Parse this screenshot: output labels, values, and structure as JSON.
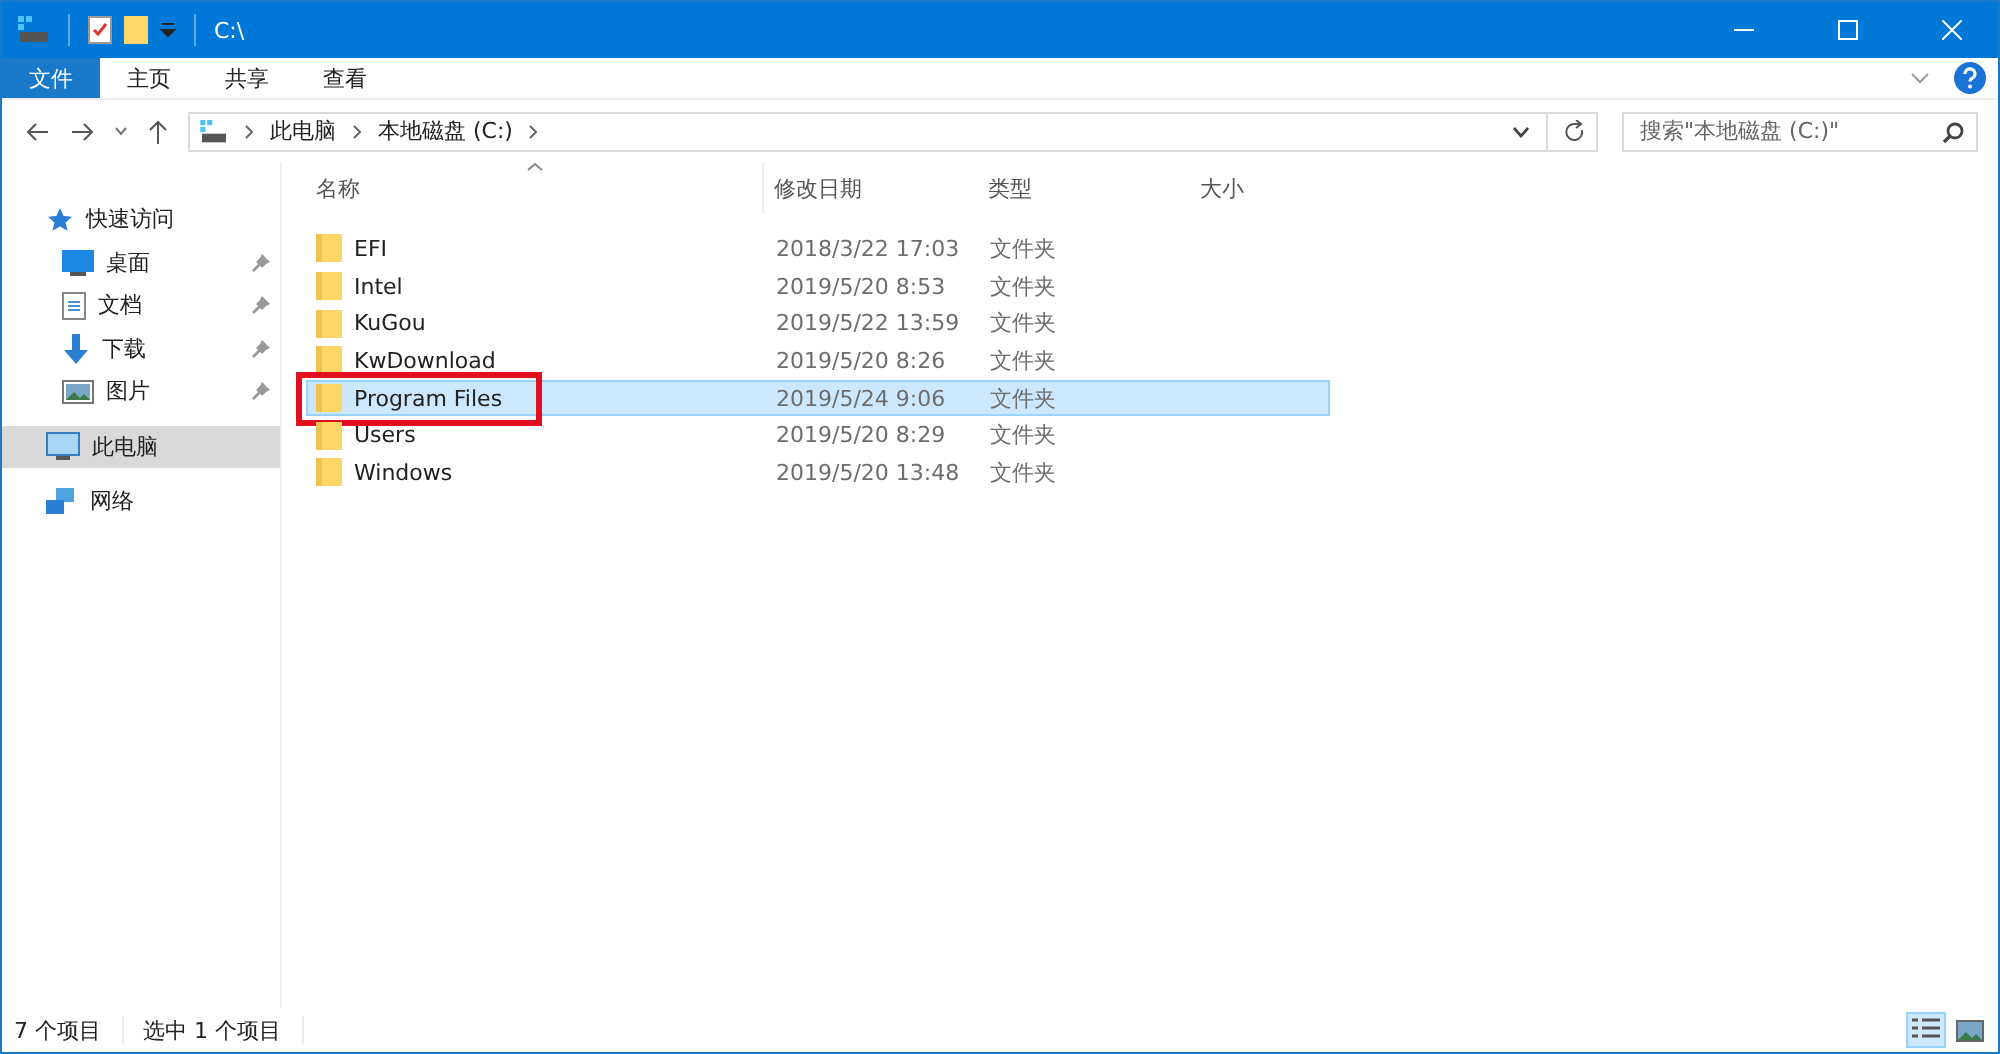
{
  "window": {
    "title": "C:\\"
  },
  "ribbon_tabs": [
    {
      "label": "文件",
      "selected": true
    },
    {
      "label": "主页",
      "selected": false
    },
    {
      "label": "共享",
      "selected": false
    },
    {
      "label": "查看",
      "selected": false
    }
  ],
  "address": {
    "crumbs": [
      "此电脑",
      "本地磁盘 (C:)"
    ]
  },
  "search": {
    "placeholder": "搜索\"本地磁盘 (C:)\""
  },
  "sidebar": {
    "items": [
      {
        "label": "快速访问",
        "kind": "quick",
        "selected": false,
        "pinned": false,
        "children": [
          {
            "label": "桌面",
            "kind": "desktop",
            "selected": false,
            "pinned": true
          },
          {
            "label": "文档",
            "kind": "docs",
            "selected": false,
            "pinned": true
          },
          {
            "label": "下载",
            "kind": "download",
            "selected": false,
            "pinned": true
          },
          {
            "label": "图片",
            "kind": "pictures",
            "selected": false,
            "pinned": true
          }
        ]
      },
      {
        "label": "此电脑",
        "kind": "pc",
        "selected": true,
        "pinned": false
      },
      {
        "label": "网络",
        "kind": "network",
        "selected": false,
        "pinned": false
      }
    ]
  },
  "table": {
    "columns": [
      "名称",
      "修改日期",
      "类型",
      "大小"
    ],
    "rows": [
      {
        "name": "EFI",
        "date": "2018/3/22 17:03",
        "type": "文件夹",
        "selected": false,
        "highlighted": false
      },
      {
        "name": "Intel",
        "date": "2019/5/20 8:53",
        "type": "文件夹",
        "selected": false,
        "highlighted": false
      },
      {
        "name": "KuGou",
        "date": "2019/5/22 13:59",
        "type": "文件夹",
        "selected": false,
        "highlighted": false
      },
      {
        "name": "KwDownload",
        "date": "2019/5/20 8:26",
        "type": "文件夹",
        "selected": false,
        "highlighted": false
      },
      {
        "name": "Program Files",
        "date": "2019/5/24 9:06",
        "type": "文件夹",
        "selected": true,
        "highlighted": true
      },
      {
        "name": "Users",
        "date": "2019/5/20 8:29",
        "type": "文件夹",
        "selected": false,
        "highlighted": false
      },
      {
        "name": "Windows",
        "date": "2019/5/20 13:48",
        "type": "文件夹",
        "selected": false,
        "highlighted": false
      }
    ]
  },
  "status_bar": {
    "count": "7 个项目",
    "selection": "选中 1 个项目"
  }
}
